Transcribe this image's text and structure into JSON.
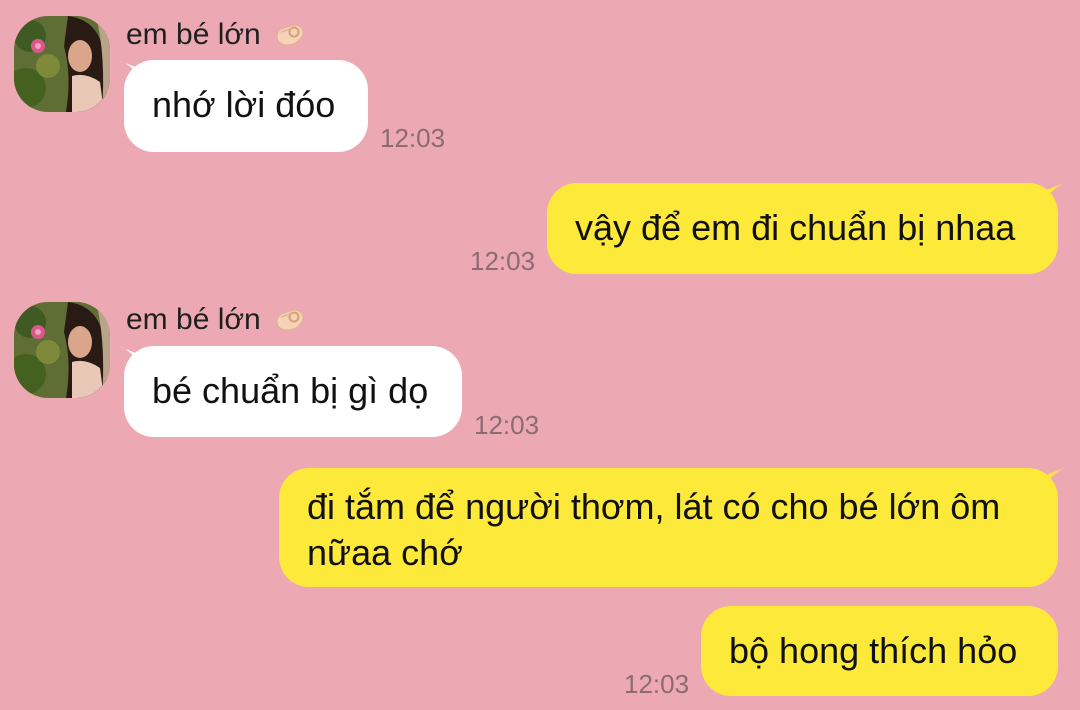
{
  "colors": {
    "background": "#eda9b3",
    "incoming_bubble": "#ffffff",
    "outgoing_bubble": "#fde93a",
    "timestamp": "#8a6c72"
  },
  "sender": {
    "name": "em bé lớn",
    "emoji_icon": "ok-hand-emoji-icon",
    "avatar_icon": "profile-photo-avatar"
  },
  "messages": [
    {
      "direction": "in",
      "text": "nhớ lời đóo",
      "time": "12:03"
    },
    {
      "direction": "out",
      "text": "vậy để em đi chuẩn bị nhaa",
      "time": "12:03"
    },
    {
      "direction": "in",
      "text": "bé chuẩn bị gì dọ",
      "time": "12:03"
    },
    {
      "direction": "out",
      "text": "đi tắm để người thơm, lát có cho bé lớn ôm nữaa chớ",
      "time": ""
    },
    {
      "direction": "out",
      "text": "bộ hong thích hỏo",
      "time": "12:03"
    }
  ]
}
